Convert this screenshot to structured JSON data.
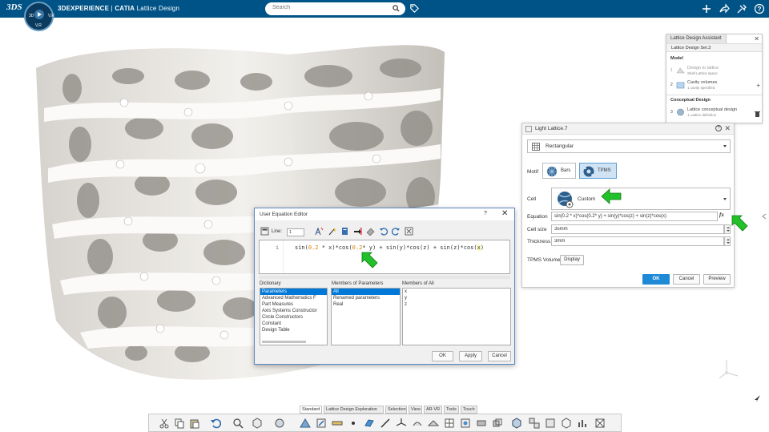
{
  "header": {
    "brand": "3DS",
    "compass": {
      "left": "3D",
      "right": "V,R",
      "version": "V,R"
    },
    "title_bold": "3DEXPERIENCE",
    "title_sep": " | ",
    "title_catia": "CATIA",
    "title_app": " Lattice Design",
    "search_placeholder": "Search"
  },
  "assistant": {
    "tab": "Lattice Design Assistant",
    "set": "Lattice Design Set.3",
    "model_heading": "Model",
    "steps": [
      {
        "num": "1",
        "title": "Design to lattice",
        "sub": "Shell Lattice space"
      },
      {
        "num": "2",
        "title": "Cavity volumes",
        "sub": "1 cavity specified"
      },
      {
        "num": "3",
        "title": "Lattice conceptual design",
        "sub": "1 Lattice definition"
      }
    ],
    "conceptual_heading": "Conceptual Design"
  },
  "light_lattice": {
    "title": "Light Lattice.7",
    "type": "Rectangular",
    "motif_label": "Motif",
    "motif_bars": "Bars",
    "motif_tpms": "TPMS",
    "cell_label": "Cell",
    "cell_value": "Custom",
    "equation_label": "Equation",
    "equation_value": "sin(0.2 * x)*cos(0.2* y) + sin(y)*cos(z) + sin(z)*cos(x)",
    "cell_size_label": "Cell size",
    "cell_size_value": "35mm",
    "thickness_label": "Thickness",
    "thickness_value": "3mm",
    "tpms_volume_label": "TPMS Volume",
    "display_label": "Display",
    "ok": "OK",
    "cancel": "Cancel",
    "preview": "Preview",
    "fx": "fx"
  },
  "equation_editor": {
    "title": "User Equation Editor",
    "help": "?",
    "line_label": "Line:",
    "line_value": "1",
    "line_number": "1",
    "code": {
      "p1": "sin(",
      "n1": "0.2",
      "p2": " * x)*cos(",
      "n2": "0.2",
      "p3": "* y) + sin(y)*cos(z) + sin(z)*cos(",
      "p4": "x",
      "p5": ")"
    },
    "dictionary_label": "Dictionary",
    "dictionary": [
      "Parameters",
      "Advanced Mathematics F",
      "Part Measures",
      "Axis Systems Constructor",
      "Circle Constructors",
      "Constant",
      "Design Table"
    ],
    "members_params_label": "Members of Parameters",
    "members_params": [
      "All",
      "Renamed parameters",
      "Real"
    ],
    "members_all_label": "Members of All",
    "members_all": [
      "x",
      "y",
      "z"
    ],
    "ok": "OK",
    "apply": "Apply",
    "cancel": "Cancel"
  },
  "bottom_tabs": [
    "Standard",
    "Lattice Design Exploration",
    "Selection",
    "View",
    "AR-VR",
    "Tools",
    "Touch"
  ],
  "colors": {
    "header": "#005386",
    "accent": "#1e8ad6",
    "arrow": "#22c12a"
  }
}
